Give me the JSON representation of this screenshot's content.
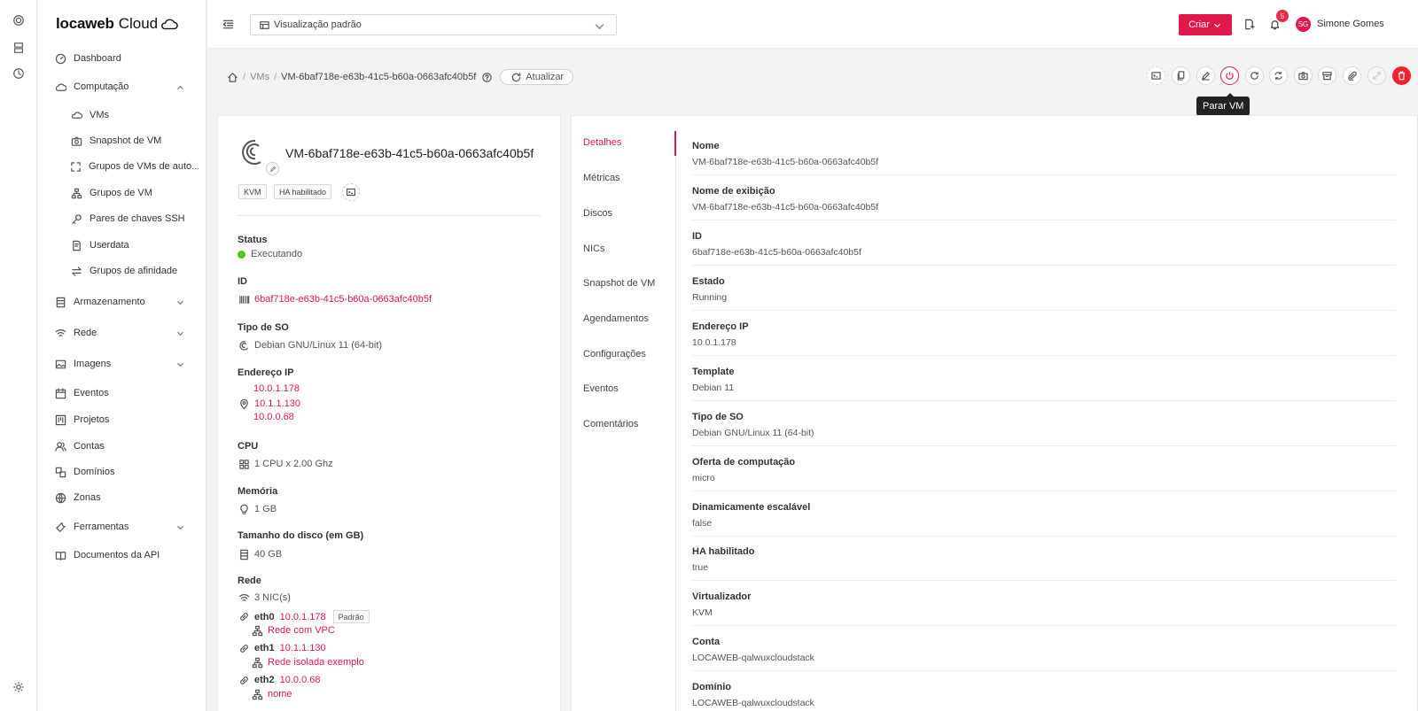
{
  "brand": {
    "name_bold": "locaweb",
    "name_rest": "Cloud"
  },
  "sidebar": {
    "items": [
      {
        "label": "Dashboard"
      },
      {
        "label": "Computação"
      },
      {
        "label": "VMs"
      },
      {
        "label": "Snapshot de VM"
      },
      {
        "label": "Grupos de VMs de auto..."
      },
      {
        "label": "Grupos de VM"
      },
      {
        "label": "Pares de chaves SSH"
      },
      {
        "label": "Userdata"
      },
      {
        "label": "Grupos de afinidade"
      },
      {
        "label": "Armazenamento"
      },
      {
        "label": "Rede"
      },
      {
        "label": "Imagens"
      },
      {
        "label": "Eventos"
      },
      {
        "label": "Projetos"
      },
      {
        "label": "Contas"
      },
      {
        "label": "Domínios"
      },
      {
        "label": "Zonas"
      },
      {
        "label": "Ferramentas"
      },
      {
        "label": "Documentos da API"
      }
    ]
  },
  "header": {
    "view_select": "Visualização padrão",
    "create_label": "Criar",
    "notifications": "5",
    "avatar": "SG",
    "user": "Simone Gomes"
  },
  "breadcrumb": {
    "vms": "VMs",
    "current": "VM-6baf718e-e63b-41c5-b60a-0663afc40b5f",
    "refresh": "Atualizar"
  },
  "tooltip": "Parar VM",
  "vm": {
    "title": "VM-6baf718e-e63b-41c5-b60a-0663afc40b5f",
    "tags": [
      "KVM",
      "HA habilitado"
    ],
    "status_label": "Status",
    "status": "Executando",
    "id_label": "ID",
    "id": "6baf718e-e63b-41c5-b60a-0663afc40b5f",
    "os_label": "Tipo de SO",
    "os": "Debian GNU/Linux 11 (64-bit)",
    "ip_label": "Endereço IP",
    "ips": [
      "10.0.1.178",
      "10.1.1.130",
      "10.0.0.68"
    ],
    "cpu_label": "CPU",
    "cpu": "1 CPU x 2.00 Ghz",
    "mem_label": "Memória",
    "mem": "1 GB",
    "disk_label": "Tamanho do disco (em GB)",
    "disk": "40 GB",
    "net_label": "Rede",
    "nic_count": "3 NIC(s)",
    "nics": [
      {
        "name": "eth0",
        "ip": "10.0.1.178",
        "network": "Rede com VPC",
        "default": "Padrão"
      },
      {
        "name": "eth1",
        "ip": "10.1.1.130",
        "network": "Rede isolada exemplo"
      },
      {
        "name": "eth2",
        "ip": "10.0.0.68",
        "network": "nome"
      }
    ]
  },
  "tabs": [
    "Detalhes",
    "Métricas",
    "Discos",
    "NICs",
    "Snapshot de VM",
    "Agendamentos",
    "Configurações",
    "Eventos",
    "Comentários"
  ],
  "details": [
    {
      "k": "Nome",
      "v": "VM-6baf718e-e63b-41c5-b60a-0663afc40b5f"
    },
    {
      "k": "Nome de exibição",
      "v": "VM-6baf718e-e63b-41c5-b60a-0663afc40b5f"
    },
    {
      "k": "ID",
      "v": "6baf718e-e63b-41c5-b60a-0663afc40b5f"
    },
    {
      "k": "Estado",
      "v": "Running"
    },
    {
      "k": "Endereço IP",
      "v": "10.0.1.178"
    },
    {
      "k": "Template",
      "v": "Debian 11"
    },
    {
      "k": "Tipo de SO",
      "v": "Debian GNU/Linux 11 (64-bit)"
    },
    {
      "k": "Oferta de computação",
      "v": "micro"
    },
    {
      "k": "Dinamicamente escalável",
      "v": "false"
    },
    {
      "k": "HA habilitado",
      "v": "true"
    },
    {
      "k": "Virtualizador",
      "v": "KVM"
    },
    {
      "k": "Conta",
      "v": "LOCAWEB-qalwuxcloudstack"
    },
    {
      "k": "Domínio",
      "v": "LOCAWEB-qalwuxcloudstack"
    }
  ],
  "colors": {
    "accent": "#e0184a",
    "status_running": "#52c41a",
    "danger": "#f5222d"
  }
}
